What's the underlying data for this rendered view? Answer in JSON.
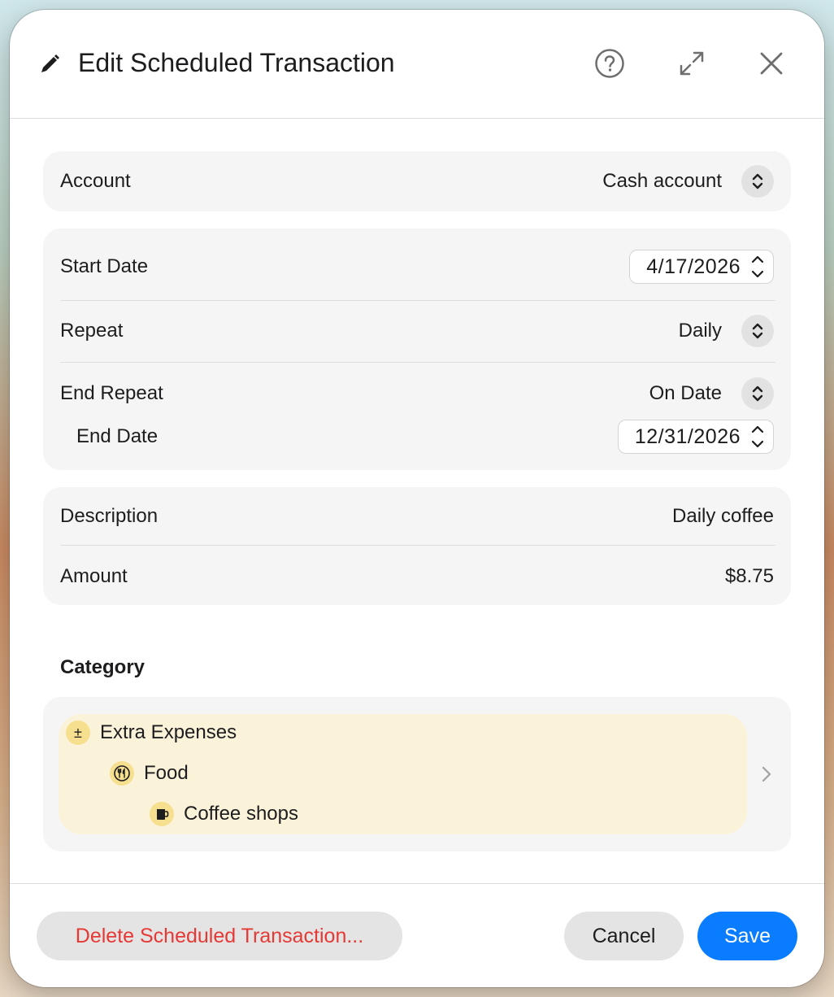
{
  "header": {
    "title": "Edit Scheduled Transaction",
    "icons": [
      "pencil-icon",
      "help-icon",
      "expand-icon",
      "close-icon"
    ]
  },
  "account": {
    "label": "Account",
    "value": "Cash account"
  },
  "schedule": {
    "start_date_label": "Start Date",
    "start_date_value": "4/17/2026",
    "repeat_label": "Repeat",
    "repeat_value": "Daily",
    "end_repeat_label": "End Repeat",
    "end_repeat_value": "On Date",
    "end_date_label": "End Date",
    "end_date_value": "12/31/2026"
  },
  "details": {
    "description_label": "Description",
    "description_value": "Daily coffee",
    "amount_label": "Amount",
    "amount_value": "$8.75"
  },
  "category": {
    "section_label": "Category",
    "path": [
      {
        "label": "Extra Expenses",
        "icon": "plus-minus-icon",
        "glyph": "±"
      },
      {
        "label": "Food",
        "icon": "fork-knife-icon"
      },
      {
        "label": "Coffee shops",
        "icon": "coffee-cup-icon"
      }
    ]
  },
  "footer": {
    "delete_label": "Delete Scheduled Transaction...",
    "cancel_label": "Cancel",
    "save_label": "Save"
  },
  "colors": {
    "accent": "#0a7cff",
    "destructive": "#e53935",
    "category_highlight": "#fbf3d9",
    "category_badge": "#f6df8f"
  }
}
